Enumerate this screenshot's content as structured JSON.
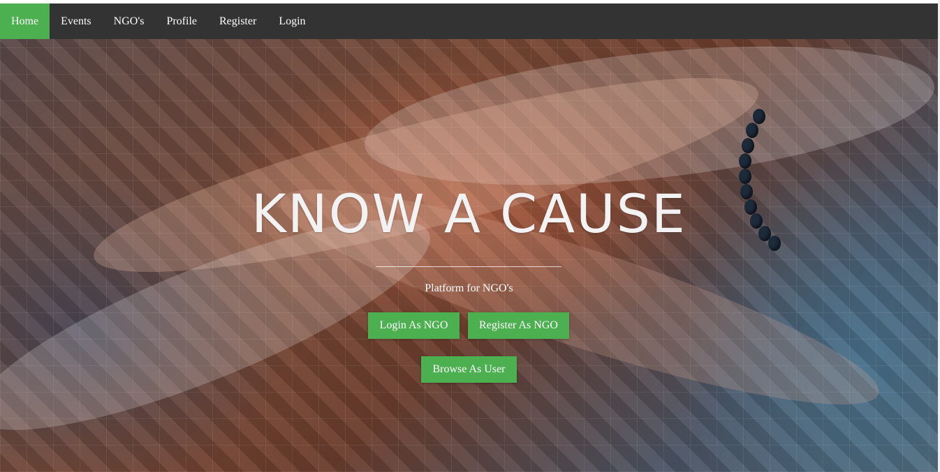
{
  "navbar": {
    "items": [
      {
        "label": "Home",
        "active": true
      },
      {
        "label": "Events",
        "active": false
      },
      {
        "label": "NGO's",
        "active": false
      },
      {
        "label": "Profile",
        "active": false
      },
      {
        "label": "Register",
        "active": false
      },
      {
        "label": "Login",
        "active": false
      }
    ]
  },
  "hero": {
    "title": "KNOW A CAUSE",
    "subtitle": "Platform for NGO's",
    "buttons": {
      "login_ngo": "Login As NGO",
      "register_ngo": "Register As NGO",
      "browse_user": "Browse As User"
    }
  },
  "colors": {
    "navbar_bg": "#333333",
    "accent_green": "#4caf50",
    "text_light": "#ffffff"
  }
}
